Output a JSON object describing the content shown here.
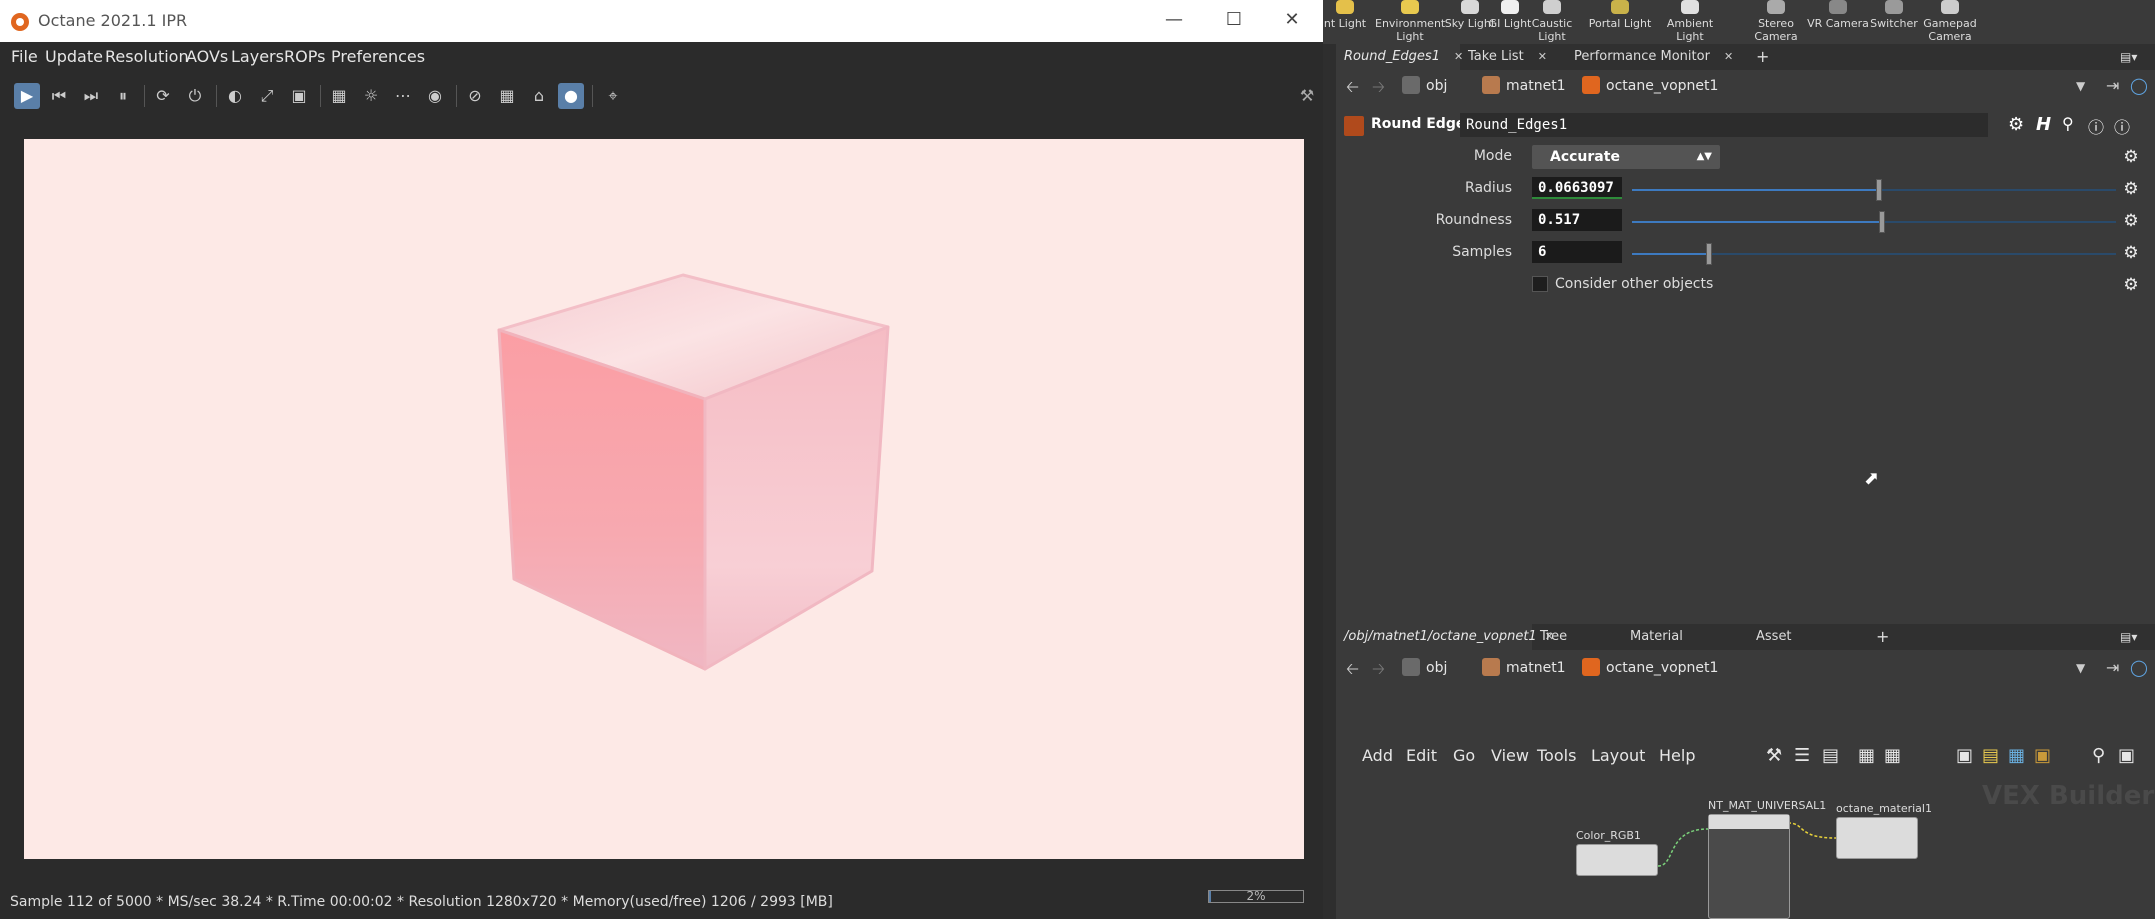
{
  "octane": {
    "window_title": "Octane 2021.1 IPR",
    "menu": [
      "File",
      "Update",
      "Resolution",
      "AOVs",
      "Layers",
      "ROPs",
      "Preferences"
    ],
    "status": "Sample 112 of 5000 * MS/sec 38.24 * R.Time 00:00:02 * Resolution 1280x720 * Memory(used/free) 1206 / 2993 [MB]",
    "progress_pct": 2,
    "progress_label": "2%",
    "toolbar_icons": [
      "start-render-icon",
      "restart-icon",
      "previous-icon",
      "pause-icon",
      "refresh-icon",
      "power-icon",
      "contrast-icon",
      "fit-icon",
      "region-icon",
      "focus-pick-icon",
      "sun-icon",
      "dots-icon",
      "target-icon",
      "clay-icon",
      "grid-icon",
      "home-icon",
      "lock-icon",
      "crop-icon"
    ]
  },
  "shelf": {
    "items": [
      {
        "label1": "nt Light",
        "label2": "",
        "icon": "light-icon",
        "color": "#e4c04a"
      },
      {
        "label1": "Environment",
        "label2": "Light",
        "icon": "env-light-icon",
        "color": "#e8c94f"
      },
      {
        "label1": "Sky Light",
        "label2": "",
        "icon": "sky-light-icon",
        "color": "#d8d8d8"
      },
      {
        "label1": "GI Light",
        "label2": "",
        "icon": "gi-light-icon",
        "color": "#f0f0f0"
      },
      {
        "label1": "Caustic Light",
        "label2": "",
        "icon": "caustic-light-icon",
        "color": "#cfcfcf"
      },
      {
        "label1": "Portal Light",
        "label2": "",
        "icon": "portal-light-icon",
        "color": "#c9b24a"
      },
      {
        "label1": "Ambient Light",
        "label2": "",
        "icon": "ambient-light-icon",
        "color": "#e0e0e0"
      },
      {
        "label1": "Stereo",
        "label2": "Camera",
        "icon": "stereo-camera-icon",
        "color": "#aaaaaa"
      },
      {
        "label1": "VR Camera",
        "label2": "",
        "icon": "vr-camera-icon",
        "color": "#888888"
      },
      {
        "label1": "Switcher",
        "label2": "",
        "icon": "switcher-icon",
        "color": "#9a9a9a"
      },
      {
        "label1": "Gamepad",
        "label2": "Camera",
        "icon": "gamepad-icon",
        "color": "#cccccc"
      }
    ]
  },
  "params_pane": {
    "tabs": [
      {
        "label": "Round_Edges1",
        "active": true
      },
      {
        "label": "Take List",
        "active": false
      },
      {
        "label": "Performance Monitor",
        "active": false
      }
    ],
    "path": [
      "obj",
      "matnet1",
      "octane_vopnet1"
    ],
    "node_type": "Round Edges",
    "node_name": "Round_Edges1",
    "mode_label": "Mode",
    "mode_value": "Accurate",
    "radius_label": "Radius",
    "radius_value": "0.0663097",
    "radius_frac": 0.51,
    "roundness_label": "Roundness",
    "roundness_value": "0.517",
    "roundness_frac": 0.517,
    "samples_label": "Samples",
    "samples_value": "6",
    "samples_frac": 0.16,
    "consider_label": "Consider other objects"
  },
  "network_pane": {
    "tabs": [
      {
        "label": "/obj/matnet1/octane_vopnet1",
        "active": true
      },
      {
        "label": "Tree View",
        "active": false
      },
      {
        "label": "Material Palette",
        "active": false
      },
      {
        "label": "Asset Browser",
        "active": false
      }
    ],
    "path": [
      "obj",
      "matnet1",
      "octane_vopnet1"
    ],
    "menu": [
      "Add",
      "Edit",
      "Go",
      "View",
      "Tools",
      "Layout",
      "Help"
    ],
    "watermark": "VEX Builder",
    "nodes": {
      "color": "Color_RGB1",
      "universal": "NT_MAT_UNIVERSAL1",
      "material": "octane_material1"
    }
  },
  "colors": {
    "viewport_bg": "#fde9e6",
    "accent_blue": "#3d7ac0",
    "octane_orange": "#e0661f"
  }
}
